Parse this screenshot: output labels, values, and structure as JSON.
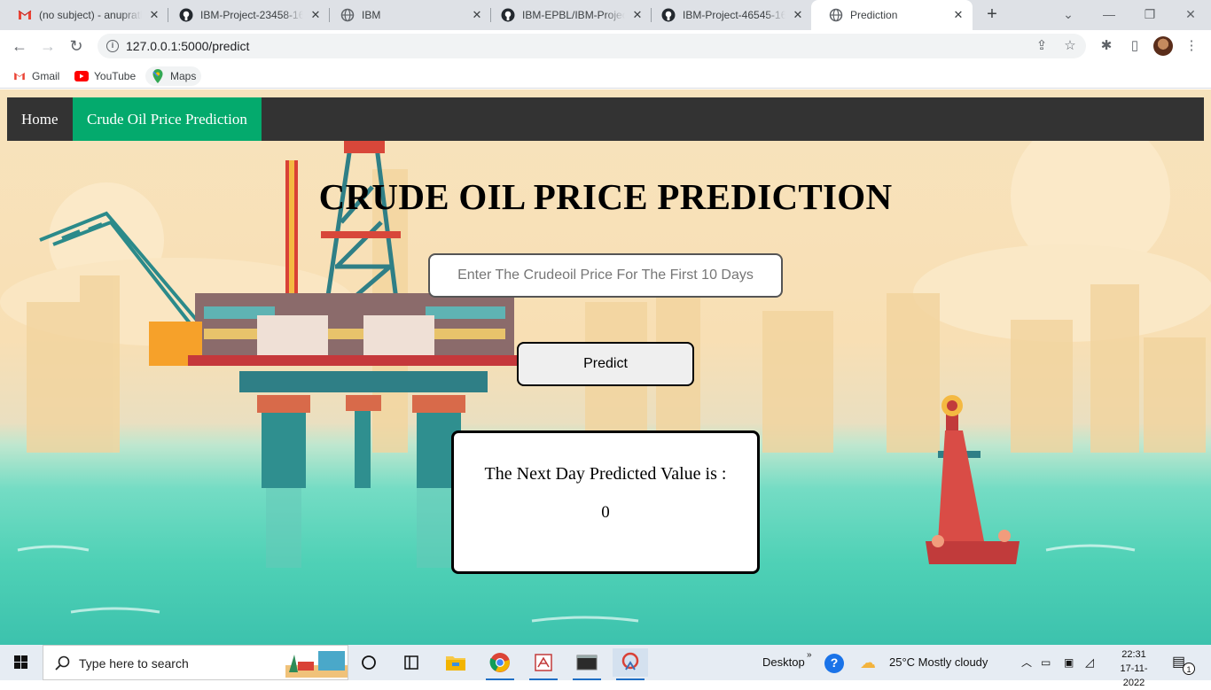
{
  "browser": {
    "tabs": [
      {
        "title": "(no subject) - anupratl",
        "icon": "gmail-icon"
      },
      {
        "title": "IBM-Project-23458-16",
        "icon": "github-icon"
      },
      {
        "title": "IBM",
        "icon": "globe-icon"
      },
      {
        "title": "IBM-EPBL/IBM-Project",
        "icon": "github-icon"
      },
      {
        "title": "IBM-Project-46545-16",
        "icon": "github-icon"
      },
      {
        "title": "Prediction",
        "icon": "globe-icon",
        "active": true
      }
    ],
    "url": "127.0.0.1:5000/predict",
    "bookmarks": [
      {
        "label": "Gmail",
        "icon": "gmail-icon"
      },
      {
        "label": "YouTube",
        "icon": "youtube-icon"
      },
      {
        "label": "Maps",
        "icon": "maps-icon"
      }
    ]
  },
  "page": {
    "nav": {
      "home": "Home",
      "prediction": "Crude Oil Price Prediction"
    },
    "title": "CRUDE OIL PRICE PREDICTION",
    "input_placeholder": "Enter The Crudeoil Price For The First 10 Days",
    "predict_label": "Predict",
    "result_label": "The Next Day Predicted Value is :",
    "result_value": "0",
    "colors": {
      "navbar": "#333333",
      "nav_active": "#04aa6d"
    }
  },
  "taskbar": {
    "search_placeholder": "Type here to search",
    "desktop_label": "Desktop",
    "weather": "25°C  Mostly cloudy",
    "time": "22:31",
    "date": "17-11-2022",
    "notification_count": "1"
  }
}
